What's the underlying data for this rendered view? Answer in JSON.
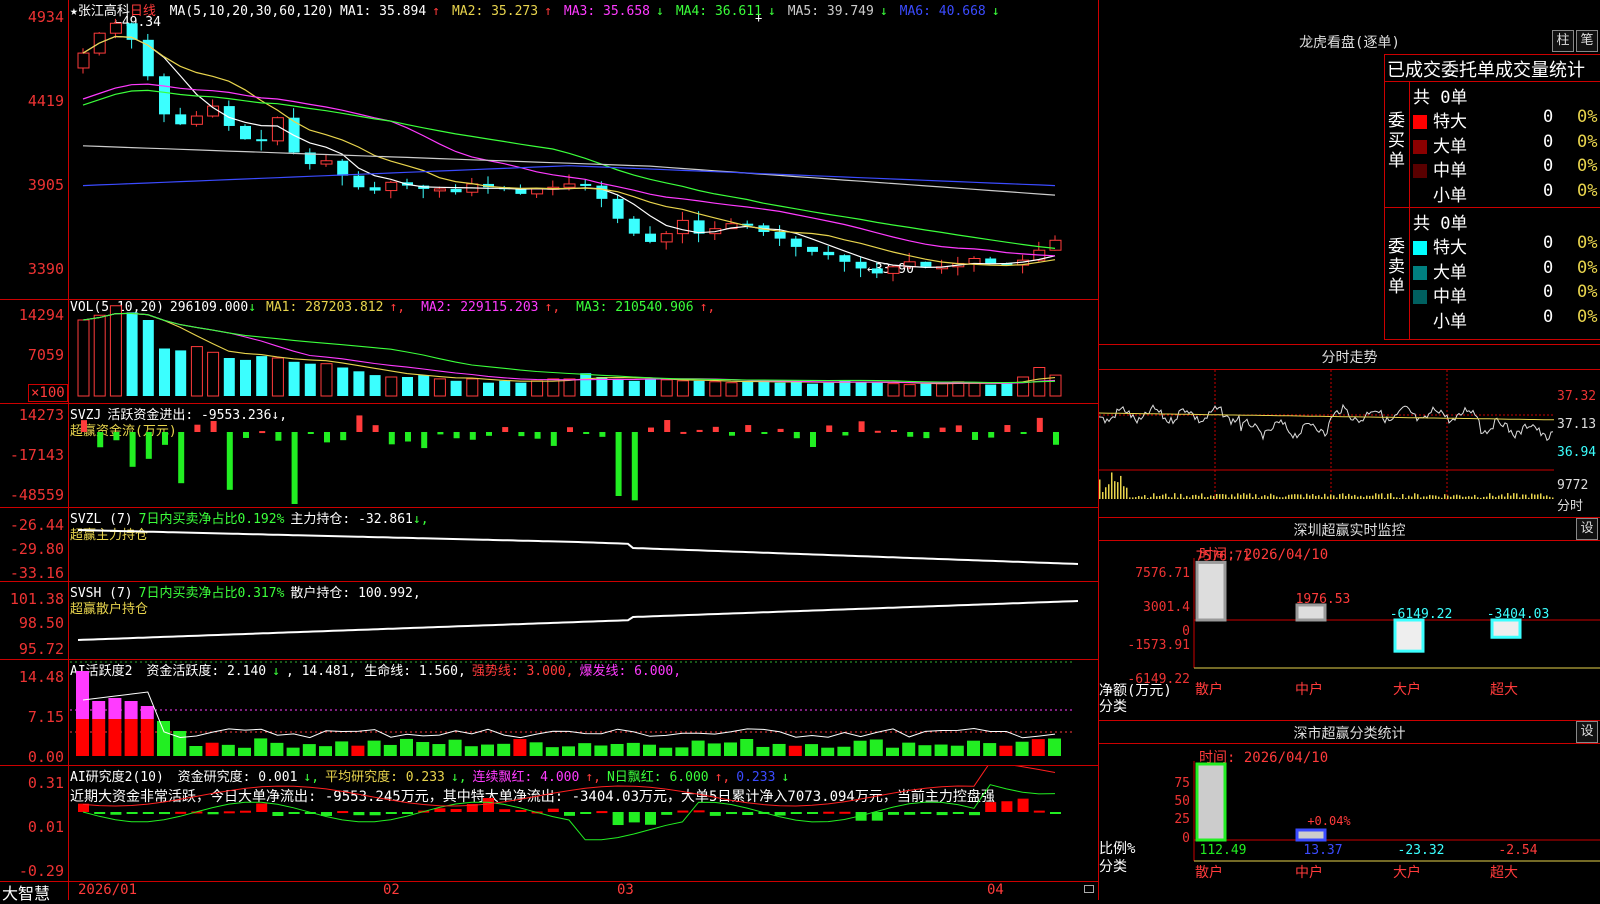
{
  "app": {
    "brand": "大智慧"
  },
  "main_chart": {
    "symbol_label": "★张江高科",
    "period": "日线",
    "ma_label": "MA(5,10,20,30,60,120)",
    "ma": [
      {
        "name": "MA1:",
        "value": "35.894",
        "arrow": "↑",
        "color": "#ffffff"
      },
      {
        "name": "MA2:",
        "value": "35.273",
        "arrow": "↑",
        "color": "#e8d44d"
      },
      {
        "name": "MA3:",
        "value": "35.658",
        "arrow": "↓",
        "color": "#ff3bff"
      },
      {
        "name": "MA4:",
        "value": "36.611",
        "arrow": "↓",
        "color": "#3bff3b"
      },
      {
        "name": "MA5:",
        "value": "39.749",
        "arrow": "↓",
        "color": "#cccccc"
      },
      {
        "name": "MA6:",
        "value": "40.668",
        "arrow": "↓",
        "color": "#3b4bff"
      }
    ],
    "y_ticks": [
      "4934",
      "4419",
      "3905",
      "3390"
    ],
    "high_label": "←49.34",
    "low_label": "←33.90"
  },
  "vol": {
    "label": "VOL(5,10,20)",
    "value": "296109.000",
    "value_arrow": "↓",
    "ma": [
      {
        "name": "MA1:",
        "value": "287203.812",
        "arrow": "↑",
        "color": "#e8d44d"
      },
      {
        "name": "MA2:",
        "value": "229115.203",
        "arrow": "↑",
        "color": "#ff3bff"
      },
      {
        "name": "MA3:",
        "value": "210540.906",
        "arrow": "↑",
        "color": "#3bff3b"
      }
    ],
    "y_ticks": [
      "14294",
      "7059"
    ],
    "unit": "×100"
  },
  "svzj": {
    "label": "SVZJ",
    "text": "活跃资金进出: -9553.236",
    "arrow": "↓,",
    "sublabel": "超赢资金流(万元)",
    "y_ticks": [
      "14273",
      "-17143",
      "-48559"
    ]
  },
  "svzl": {
    "label": "SVZL (7)",
    "pct": "7日内买卖净占比0.192%",
    "text": "主力持仓: -32.861",
    "arrow": "↓,",
    "sublabel": "超赢主力持仓",
    "y_ticks": [
      "-26.44",
      "-29.80",
      "-33.16"
    ]
  },
  "svsh": {
    "label": "SVSH (7)",
    "pct": "7日内买卖净占比0.317%",
    "text": "散户持仓: 100.992",
    "arrow": ",",
    "sublabel": "超赢散户持仓",
    "y_ticks": [
      "101.38",
      "98.50",
      "95.72"
    ]
  },
  "ai1": {
    "label": "AI活跃度2",
    "parts": [
      {
        "text": "资金活跃度: 2.140",
        "color": "#ffffff"
      },
      {
        "text": "↓",
        "color": "#3bff3b"
      },
      {
        "text": ", 14.481, 生命线: 1.560,",
        "color": "#ffffff"
      },
      {
        "text": "强势线: 3.000,",
        "color": "#ff3b3b"
      },
      {
        "text": "爆发线: 6.000,",
        "color": "#ff3bff"
      }
    ],
    "y_ticks": [
      "14.48",
      "7.15",
      "0.00"
    ]
  },
  "ai2": {
    "label": "AI研究度2(10)",
    "parts": [
      {
        "text": "资金研究度: 0.001",
        "color": "#ffffff"
      },
      {
        "text": "↓,",
        "color": "#3bff3b"
      },
      {
        "text": "平均研究度: 0.233",
        "color": "#e8d44d"
      },
      {
        "text": "↓,",
        "color": "#3bff3b"
      },
      {
        "text": "连续飘红: 4.000",
        "color": "#ff3bff"
      },
      {
        "text": "↑,",
        "color": "#ff3b3b"
      },
      {
        "text": "N日飘红: 6.000",
        "color": "#3bff3b"
      },
      {
        "text": "↑,",
        "color": "#ff3b3b"
      },
      {
        "text": "0.233",
        "color": "#3b4bff"
      },
      {
        "text": "↓",
        "color": "#3bff3b"
      }
    ],
    "note": "近期大资金非常活跃，今日大单净流出: -9553.245万元，其中特大单净流出: -3404.03万元，大单5日累计净入7073.094万元，当前主力控盘强",
    "y_ticks": [
      "0.31",
      "0.01",
      "-0.29"
    ]
  },
  "x_axis": [
    "2026/01",
    "02",
    "03",
    "04"
  ],
  "dragon": {
    "title": "龙虎看盘(逐单)",
    "btn_zhu": "柱",
    "btn_bi": "笔",
    "header": "已成交委托单成交量统计",
    "buy": {
      "side_label": "委买单",
      "total": "共 0单",
      "rows": [
        {
          "label": "特大",
          "color": "#ff0000",
          "count": "0",
          "pct": "0%"
        },
        {
          "label": "大单",
          "color": "#8b0000",
          "count": "0",
          "pct": "0%"
        },
        {
          "label": "中单",
          "color": "#5a0000",
          "count": "0",
          "pct": "0%"
        },
        {
          "label": "小单",
          "color": "#000000",
          "count": "0",
          "pct": "0%"
        }
      ]
    },
    "sell": {
      "side_label": "委卖单",
      "total": "共 0单",
      "rows": [
        {
          "label": "特大",
          "color": "#00ffff",
          "count": "0",
          "pct": "0%"
        },
        {
          "label": "大单",
          "color": "#008080",
          "count": "0",
          "pct": "0%"
        },
        {
          "label": "中单",
          "color": "#006060",
          "count": "0",
          "pct": "0%"
        },
        {
          "label": "小单",
          "color": "#000000",
          "count": "0",
          "pct": "0%"
        }
      ]
    }
  },
  "intraday": {
    "title": "分时走势",
    "y_ticks": [
      "37.32",
      "37.13",
      "36.94"
    ],
    "vol_tick": "9772",
    "vol_label": "分时"
  },
  "sz_monitor": {
    "title": "深圳超赢实时监控",
    "btn": "设",
    "time": "时间: 2026/04/10",
    "y_ticks": [
      "7576.71",
      "3001.4",
      "0",
      "-1573.91",
      "-6149.22"
    ],
    "y_label": "净额(万元)",
    "x_label": "分类",
    "categories": [
      "散户",
      "中户",
      "大户",
      "超大"
    ],
    "values": [
      7576.71,
      1976.53,
      -6149.22,
      -3404.03
    ],
    "value_labels": [
      "7576.71",
      "1976.53",
      "-6149.22",
      "-3404.03"
    ]
  },
  "sz_stats": {
    "title": "深市超赢分类统计",
    "btn": "设",
    "time": "时间: 2026/04/10",
    "y_ticks": [
      "75",
      "50",
      "25",
      "0"
    ],
    "y_label": "比例%",
    "x_label": "分类",
    "categories": [
      "散户",
      "中户",
      "大户",
      "超大"
    ],
    "values": [
      112.49,
      13.37,
      -23.32,
      -2.54
    ],
    "value_labels": [
      "112.49",
      "13.37",
      "-23.32",
      "-2.54"
    ],
    "annotation": "+0.04%"
  }
}
